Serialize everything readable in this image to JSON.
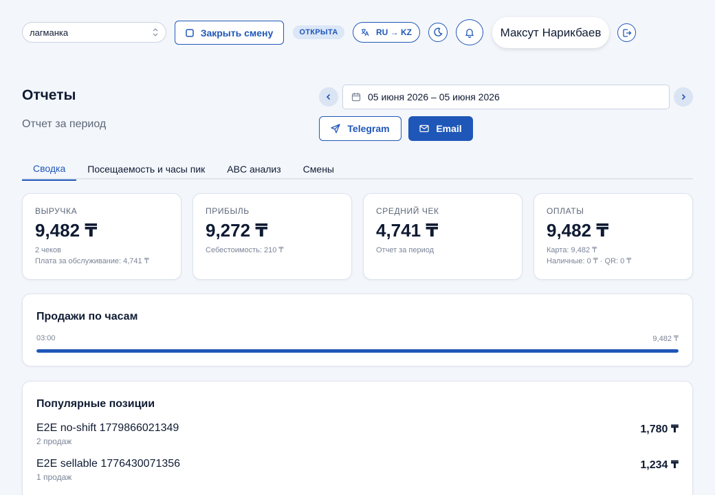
{
  "topbar": {
    "venue_select": "лагманка",
    "close_shift_label": "Закрыть смену",
    "status_badge": "ОТКРЫТА",
    "lang_toggle": "RU → KZ",
    "user_name": "Максут Нарикбаев",
    "icons": [
      "chevron-updown-icon",
      "square-icon",
      "translate-icon",
      "moon-icon",
      "bell-icon",
      "logout-icon"
    ]
  },
  "header": {
    "title": "Отчеты",
    "subtitle": "Отчет за период",
    "date_range": "05 июня 2026 – 05 июня 2026",
    "telegram_label": "Telegram",
    "email_label": "Email"
  },
  "tabs": [
    {
      "label": "Сводка",
      "active": true
    },
    {
      "label": "Посещаемость и часы пик",
      "active": false
    },
    {
      "label": "ABC анализ",
      "active": false
    },
    {
      "label": "Смены",
      "active": false
    }
  ],
  "metrics": [
    {
      "label": "ВЫРУЧКА",
      "value": "9,482 ₸",
      "sub1": "2 чеков",
      "sub2": "Плата за обслуживание: 4,741 ₸"
    },
    {
      "label": "ПРИБЫЛЬ",
      "value": "9,272 ₸",
      "sub1": "Себестоимость: 210 ₸",
      "sub2": ""
    },
    {
      "label": "СРЕДНИЙ ЧЕК",
      "value": "4,741 ₸",
      "sub1": "Отчет за период",
      "sub2": ""
    },
    {
      "label": "ОПЛАТЫ",
      "value": "9,482 ₸",
      "sub1": "Карта: 9,482 ₸",
      "sub2": "Наличные: 0 ₸ · QR: 0 ₸"
    }
  ],
  "hourly": {
    "title": "Продажи по часам",
    "hour": "03:00",
    "amount": "9,482 ₸",
    "fill_fraction": 1.0
  },
  "popular": {
    "title": "Популярные позиции",
    "items": [
      {
        "name": "E2E no-shift 1779866021349",
        "count": "2 продаж",
        "amount": "1,780 ₸"
      },
      {
        "name": "E2E sellable 1776430071356",
        "count": "1 продаж",
        "amount": "1,234 ₸"
      }
    ]
  },
  "colors": {
    "accent": "#1f57b8",
    "background": "#f3f6fb",
    "text": "#0f1b33"
  }
}
